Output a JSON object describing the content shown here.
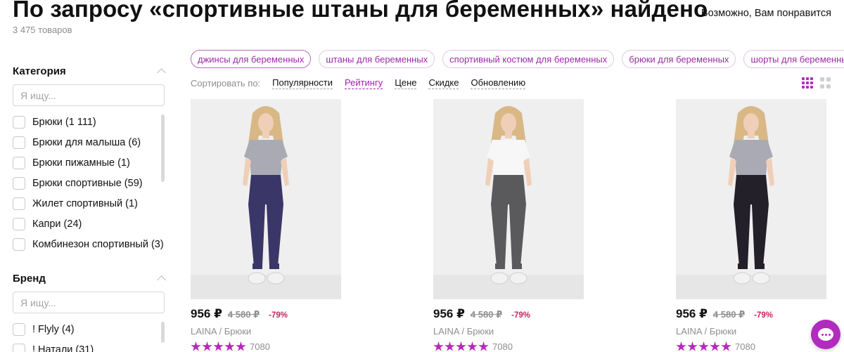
{
  "header": {
    "title": "По запросу «спортивные штаны для беременных» найдено",
    "count": "3 475 товаров",
    "recommend": "Возможно, Вам понравится"
  },
  "sidebar": {
    "category": {
      "title": "Категория",
      "placeholder": "Я ищу...",
      "items": [
        {
          "label": "Брюки (1 111)"
        },
        {
          "label": "Брюки для малыша (6)"
        },
        {
          "label": "Брюки пижамные (1)"
        },
        {
          "label": "Брюки спортивные (59)"
        },
        {
          "label": "Жилет спортивный (1)"
        },
        {
          "label": "Капри (24)"
        },
        {
          "label": "Комбинезон спортивный (3)"
        }
      ]
    },
    "brand": {
      "title": "Бренд",
      "placeholder": "Я ищу...",
      "items": [
        {
          "label": "! Flyly (4)"
        },
        {
          "label": "! Натали (31)"
        }
      ]
    }
  },
  "chips": [
    "джинсы для беременных",
    "штаны для беременных",
    "спортивный костюм для беременных",
    "брюки для беременных",
    "шорты для беременных"
  ],
  "sort": {
    "label": "Сортировать по:",
    "options": [
      "Популярности",
      "Рейтингу",
      "Цене",
      "Скидке",
      "Обновлению"
    ],
    "active": "Рейтингу"
  },
  "products": [
    {
      "price": "956 ₽",
      "old_price": "4 580 ₽",
      "discount": "-79%",
      "brand": "LAINA",
      "name": "Брюки",
      "reviews": "7080",
      "rating": 5,
      "shirt_color": "#a9aab3",
      "pants_color": "#3b3668"
    },
    {
      "price": "956 ₽",
      "old_price": "4 580 ₽",
      "discount": "-79%",
      "brand": "LAINA",
      "name": "Брюки",
      "reviews": "7080",
      "rating": 5,
      "shirt_color": "#f7f7f7",
      "pants_color": "#5a5a5c"
    },
    {
      "price": "956 ₽",
      "old_price": "4 580 ₽",
      "discount": "-79%",
      "brand": "LAINA",
      "name": "Брюки",
      "reviews": "7080",
      "rating": 5,
      "shirt_color": "#a9aab3",
      "pants_color": "#23202a"
    }
  ],
  "colors": {
    "accent": "#b12bbd",
    "discount": "#c2255c"
  }
}
